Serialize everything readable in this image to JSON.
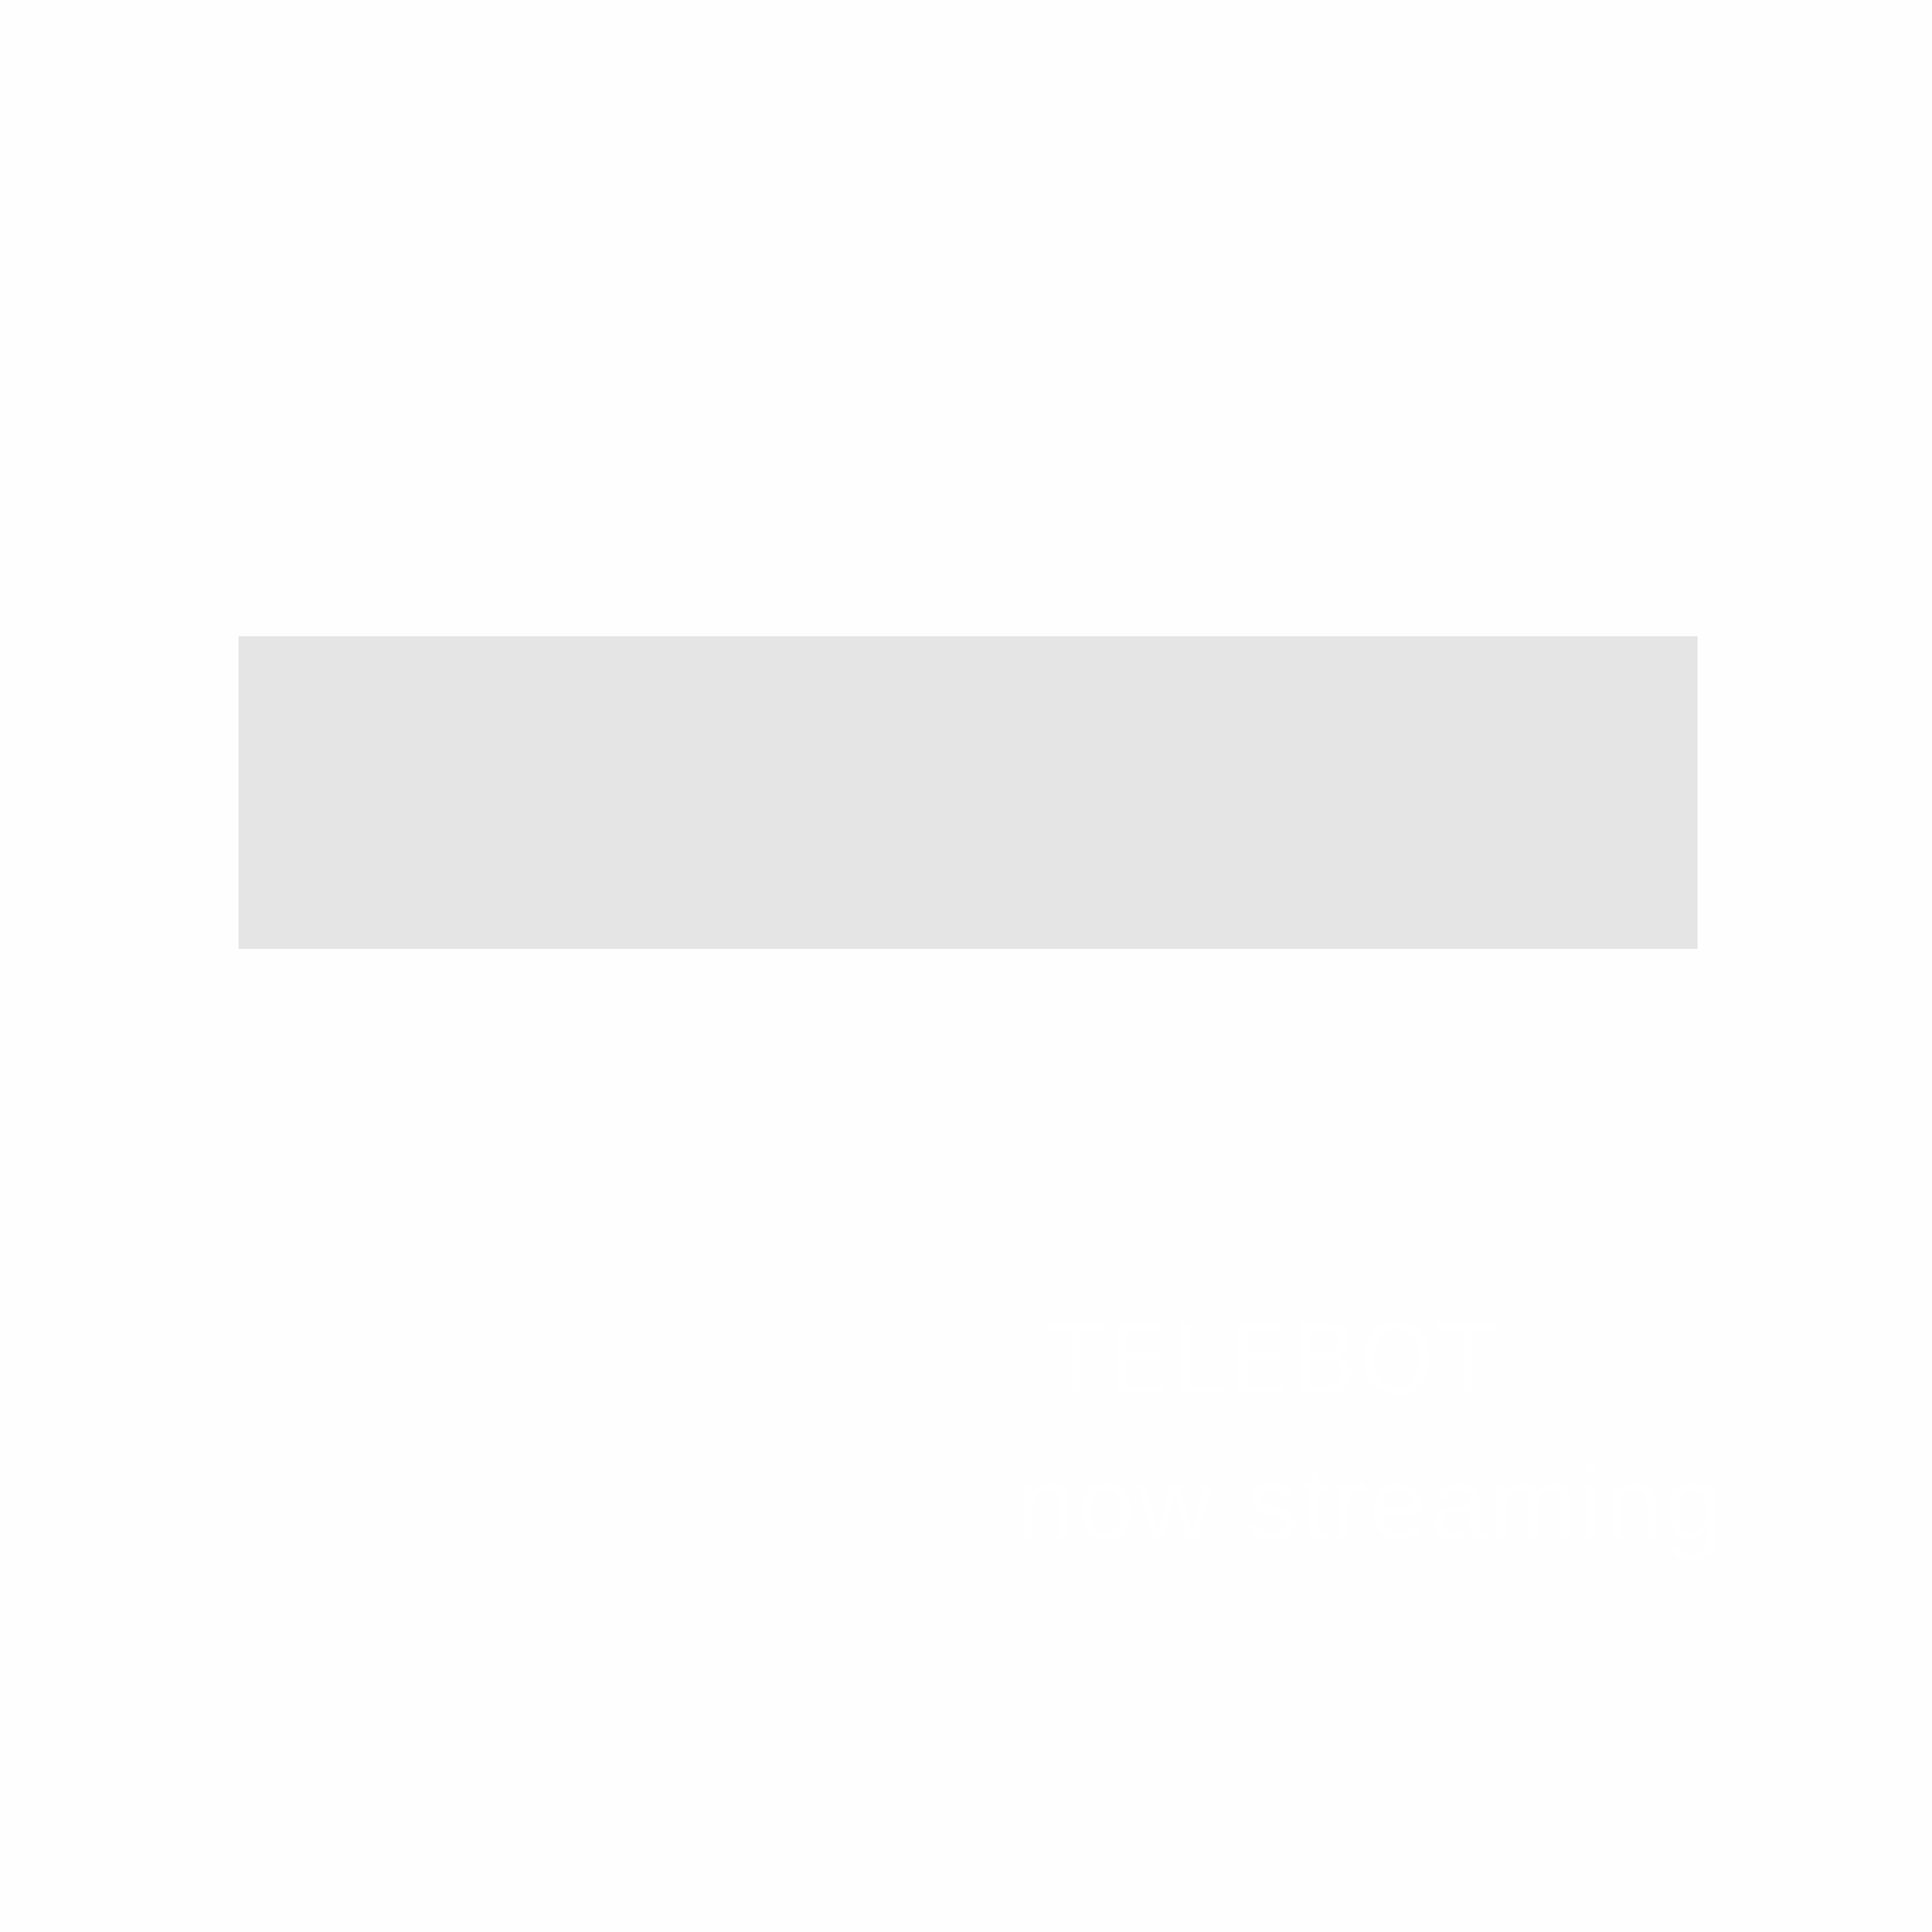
{
  "banner": {
    "title": "TELEBOT",
    "subtitle": "now streaming",
    "background_color": "#e5e5e5",
    "text_color": "#ffffff"
  },
  "page": {
    "background_color": "#fefefe"
  }
}
